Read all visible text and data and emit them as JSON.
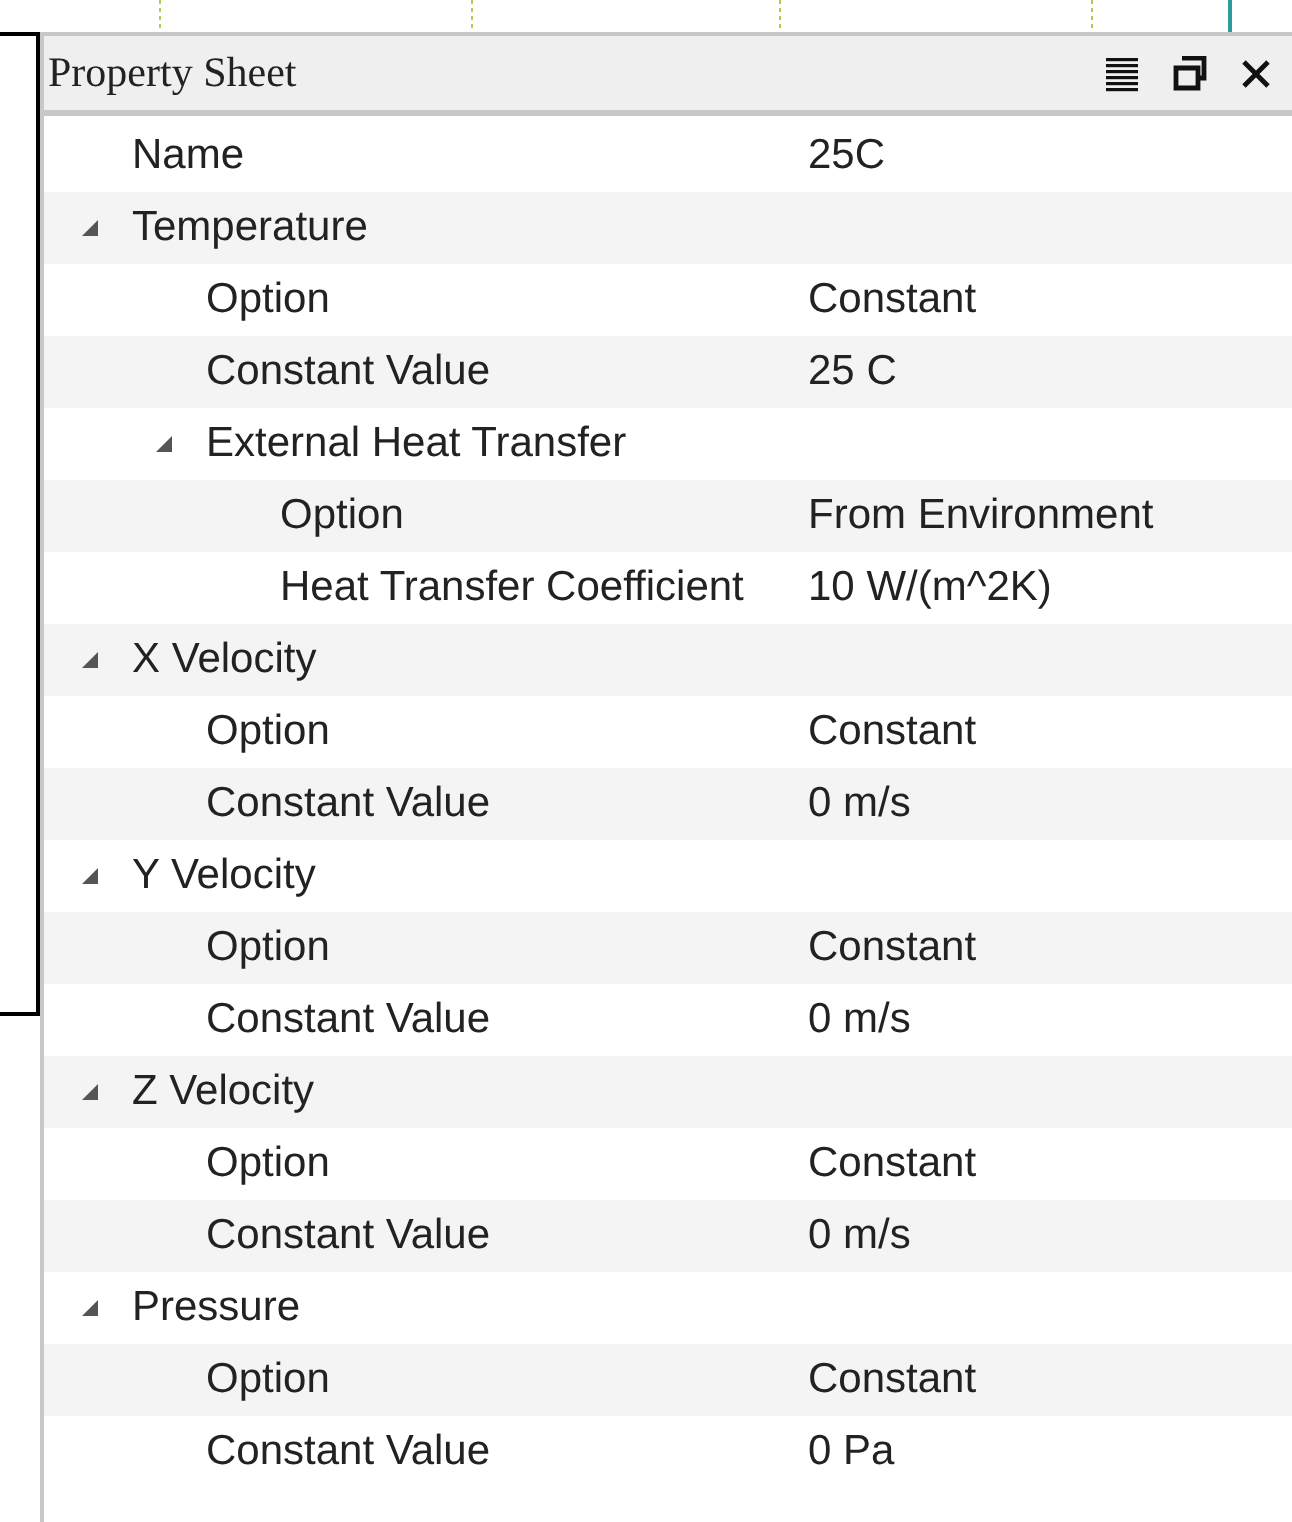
{
  "panel": {
    "title": "Property Sheet"
  },
  "properties": [
    {
      "label": "Name",
      "value": "25C"
    },
    {
      "label": "Temperature",
      "expanded": true,
      "children": [
        {
          "label": "Option",
          "value": "Constant"
        },
        {
          "label": "Constant Value",
          "value": "25 C"
        },
        {
          "label": "External Heat Transfer",
          "expanded": true,
          "children": [
            {
              "label": "Option",
              "value": "From Environment"
            },
            {
              "label": "Heat Transfer Coefficient",
              "value": "10 W/(m^2K)"
            }
          ]
        }
      ]
    },
    {
      "label": "X Velocity",
      "expanded": true,
      "children": [
        {
          "label": "Option",
          "value": "Constant"
        },
        {
          "label": "Constant Value",
          "value": "0 m/s"
        }
      ]
    },
    {
      "label": "Y Velocity",
      "expanded": true,
      "children": [
        {
          "label": "Option",
          "value": "Constant"
        },
        {
          "label": "Constant Value",
          "value": "0 m/s"
        }
      ]
    },
    {
      "label": "Z Velocity",
      "expanded": true,
      "children": [
        {
          "label": "Option",
          "value": "Constant"
        },
        {
          "label": "Constant Value",
          "value": "0 m/s"
        }
      ]
    },
    {
      "label": "Pressure",
      "expanded": true,
      "children": [
        {
          "label": "Option",
          "value": "Constant"
        },
        {
          "label": "Constant Value",
          "value": "0 Pa"
        }
      ]
    }
  ]
}
